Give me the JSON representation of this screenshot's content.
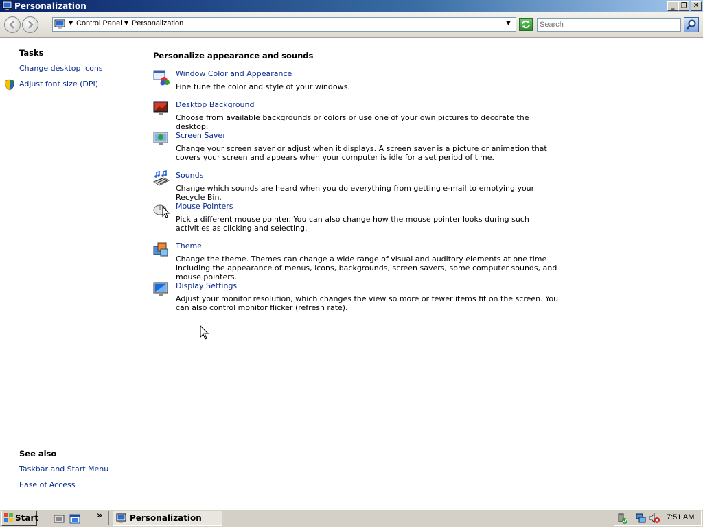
{
  "window": {
    "title": "Personalization"
  },
  "caption_buttons": {
    "minimize": "_",
    "restore": "❐",
    "close": "✕"
  },
  "address": {
    "crumbs": [
      "Control Panel",
      "Personalization"
    ]
  },
  "search": {
    "placeholder": "Search"
  },
  "sidebar": {
    "tasks_heading": "Tasks",
    "tasks": [
      "Change desktop icons",
      "Adjust font size (DPI)"
    ],
    "see_also_heading": "See also",
    "see_also": [
      "Taskbar and Start Menu",
      "Ease of Access"
    ]
  },
  "main": {
    "heading": "Personalize appearance and sounds",
    "items": [
      {
        "title": "Window Color and Appearance",
        "desc": "Fine tune the color and style of your windows."
      },
      {
        "title": "Desktop Background",
        "desc": "Choose from available backgrounds or colors or use one of your own pictures to decorate the desktop."
      },
      {
        "title": "Screen Saver",
        "desc": "Change your screen saver or adjust when it displays. A screen saver is a picture or animation that covers your screen and appears when your computer is idle for a set period of time."
      },
      {
        "title": "Sounds",
        "desc": "Change which sounds are heard when you do everything from getting e-mail to emptying your Recycle Bin."
      },
      {
        "title": "Mouse Pointers",
        "desc": "Pick a different mouse pointer. You can also change how the mouse pointer looks during such activities as clicking and selecting."
      },
      {
        "title": "Theme",
        "desc": "Change the theme. Themes can change a wide range of visual and auditory elements at one time including the appearance of menus, icons, backgrounds, screen savers, some computer sounds, and mouse pointers."
      },
      {
        "title": "Display Settings",
        "desc": "Adjust your monitor resolution, which changes the view so more or fewer items fit on the screen. You can also control monitor flicker (refresh rate)."
      }
    ]
  },
  "taskbar": {
    "start_label": "Start",
    "overflow": "»",
    "active_window": "Personalization",
    "clock": "7:51 AM"
  },
  "icons": {
    "window_color": "window-color-icon",
    "desktop_background": "desktop-background-icon",
    "screen_saver": "screen-saver-icon",
    "sounds": "sounds-icon",
    "mouse_pointers": "mouse-pointers-icon",
    "theme": "theme-icon",
    "display_settings": "display-settings-icon"
  },
  "colors": {
    "link": "#0c2d8f",
    "titlebar_start": "#0a246a",
    "titlebar_end": "#a6caf0",
    "taskbar": "#d4d0c8"
  }
}
